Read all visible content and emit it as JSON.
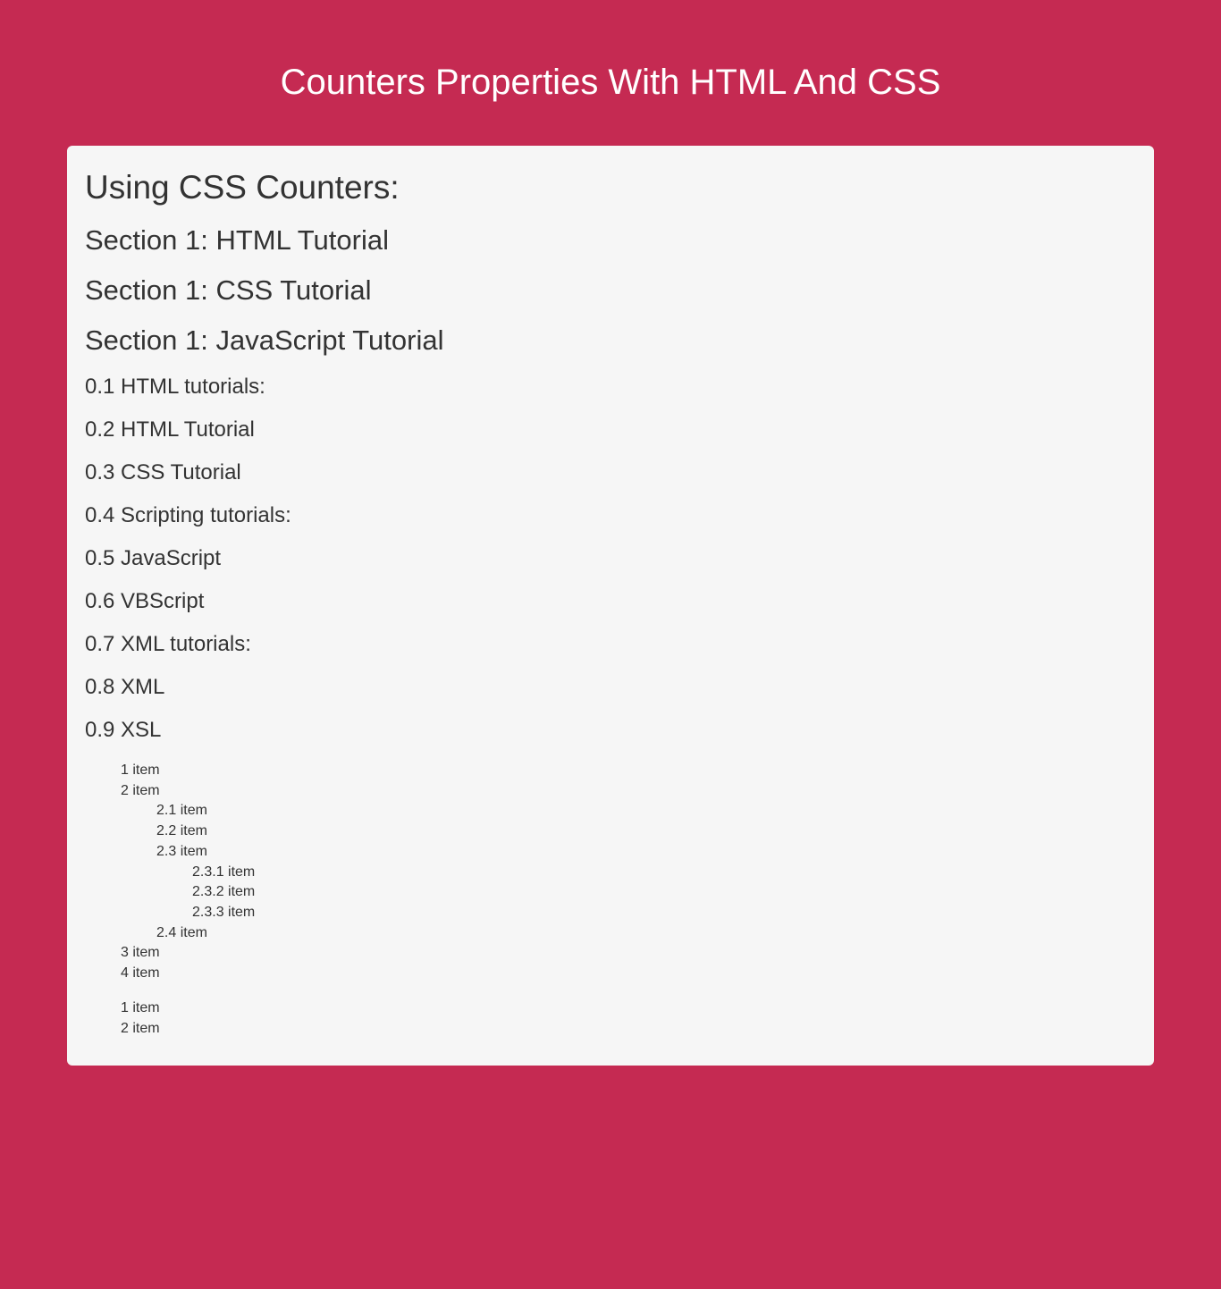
{
  "pageTitle": "Counters Properties With HTML And CSS",
  "heading1": "Using CSS Counters:",
  "sections": [
    "Section 1: HTML Tutorial",
    "Section 1: CSS Tutorial",
    "Section 1: JavaScript Tutorial"
  ],
  "subsections": [
    "0.1 HTML tutorials:",
    "0.2 HTML Tutorial",
    "0.3 CSS Tutorial",
    "0.4 Scripting tutorials:",
    "0.5 JavaScript",
    "0.6 VBScript",
    "0.7 XML tutorials:",
    "0.8 XML",
    "0.9 XSL"
  ],
  "listA": {
    "i1": "1 item",
    "i2": "2 item",
    "i2_1": "2.1 item",
    "i2_2": "2.2 item",
    "i2_3": "2.3 item",
    "i2_3_1": "2.3.1 item",
    "i2_3_2": "2.3.2 item",
    "i2_3_3": "2.3.3 item",
    "i2_4": "2.4 item",
    "i3": "3 item",
    "i4": "4 item"
  },
  "listB": {
    "i1": "1 item",
    "i2": "2 item"
  }
}
